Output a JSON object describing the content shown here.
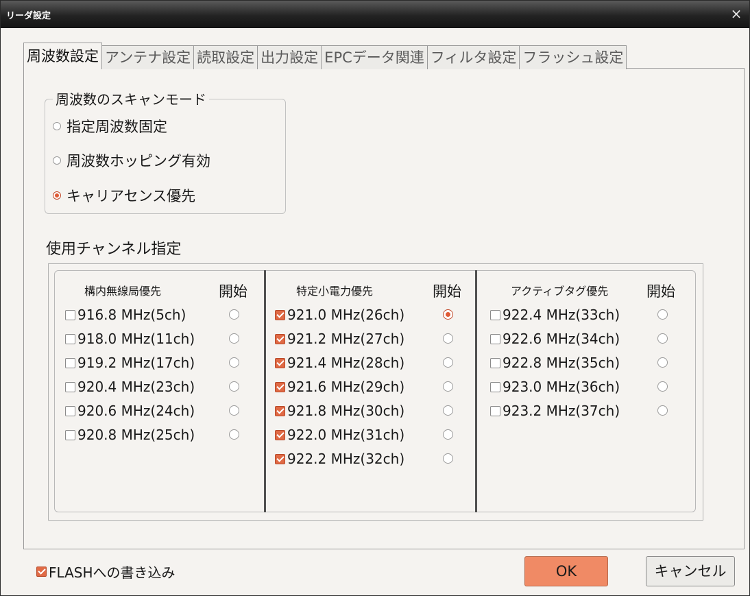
{
  "window": {
    "title": "リーダ設定",
    "close_glyph": "×"
  },
  "tabs": [
    {
      "label": "周波数設定",
      "active": true
    },
    {
      "label": "アンテナ設定"
    },
    {
      "label": "読取設定"
    },
    {
      "label": "出力設定"
    },
    {
      "label": "EPCデータ関連"
    },
    {
      "label": "フィルタ設定"
    },
    {
      "label": "フラッシュ設定"
    }
  ],
  "scan_mode": {
    "legend": "周波数のスキャンモード",
    "options": [
      {
        "label": "指定周波数固定",
        "selected": false
      },
      {
        "label": "周波数ホッピング有効",
        "selected": false
      },
      {
        "label": "キャリアセンス優先",
        "selected": true
      }
    ]
  },
  "channels": {
    "section_label": "使用チャンネル指定",
    "start_label": "開始",
    "groups": [
      {
        "title": "構内無線局優先",
        "items": [
          {
            "label": "916.8 MHz(5ch)",
            "checked": false,
            "start": false
          },
          {
            "label": "918.0 MHz(11ch)",
            "checked": false,
            "start": false
          },
          {
            "label": "919.2 MHz(17ch)",
            "checked": false,
            "start": false
          },
          {
            "label": "920.4 MHz(23ch)",
            "checked": false,
            "start": false
          },
          {
            "label": "920.6 MHz(24ch)",
            "checked": false,
            "start": false
          },
          {
            "label": "920.8 MHz(25ch)",
            "checked": false,
            "start": false
          }
        ]
      },
      {
        "title": "特定小電力優先",
        "items": [
          {
            "label": "921.0 MHz(26ch)",
            "checked": true,
            "start": true
          },
          {
            "label": "921.2 MHz(27ch)",
            "checked": true,
            "start": false
          },
          {
            "label": "921.4 MHz(28ch)",
            "checked": true,
            "start": false
          },
          {
            "label": "921.6 MHz(29ch)",
            "checked": true,
            "start": false
          },
          {
            "label": "921.8 MHz(30ch)",
            "checked": true,
            "start": false
          },
          {
            "label": "922.0 MHz(31ch)",
            "checked": true,
            "start": false
          },
          {
            "label": "922.2 MHz(32ch)",
            "checked": true,
            "start": false
          }
        ]
      },
      {
        "title": "アクティブタグ優先",
        "items": [
          {
            "label": "922.4 MHz(33ch)",
            "checked": false,
            "start": false
          },
          {
            "label": "922.6 MHz(34ch)",
            "checked": false,
            "start": false
          },
          {
            "label": "922.8 MHz(35ch)",
            "checked": false,
            "start": false
          },
          {
            "label": "923.0 MHz(36ch)",
            "checked": false,
            "start": false
          },
          {
            "label": "923.2 MHz(37ch)",
            "checked": false,
            "start": false
          }
        ]
      }
    ]
  },
  "footer": {
    "flash_label": "FLASHへの書き込み",
    "flash_checked": true,
    "ok_label": "OK",
    "cancel_label": "キャンセル"
  },
  "colors": {
    "accent": "#f08a65",
    "check": "#e06a45",
    "titlebar": "#1e1e1e"
  }
}
